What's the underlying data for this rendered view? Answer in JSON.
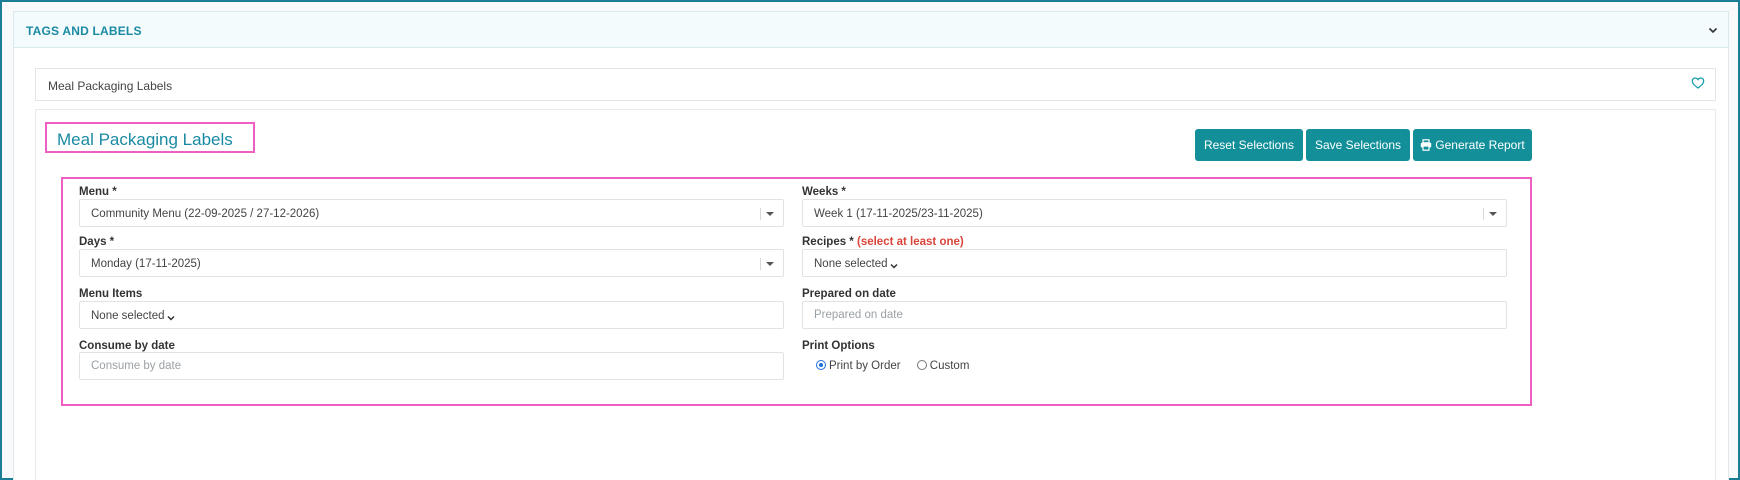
{
  "accordion": {
    "title": "TAGS AND LABELS"
  },
  "breadcrumb": {
    "label": "Meal Packaging Labels"
  },
  "page": {
    "title": "Meal Packaging Labels"
  },
  "toolbar": {
    "reset_label": "Reset Selections",
    "save_label": "Save Selections",
    "report_label": "Generate Report"
  },
  "form": {
    "menu": {
      "label": "Menu *",
      "value": "Community Menu (22-09-2025 / 27-12-2026)"
    },
    "weeks": {
      "label": "Weeks *",
      "value": "Week 1 (17-11-2025/23-11-2025)"
    },
    "days": {
      "label": "Days *",
      "value": "Monday (17-11-2025)"
    },
    "recipes": {
      "label": "Recipes *",
      "note": "(select at least one)",
      "value": "None selected"
    },
    "menu_items": {
      "label": "Menu Items",
      "value": "None selected"
    },
    "prepared_on": {
      "label": "Prepared on date",
      "placeholder": "Prepared on date"
    },
    "consume_by": {
      "label": "Consume by date",
      "placeholder": "Consume by date"
    },
    "print_options": {
      "label": "Print Options",
      "options": [
        "Print by Order",
        "Custom"
      ],
      "selected": "Print by Order"
    }
  },
  "colors": {
    "accent": "#128f99",
    "title": "#1a8aa3",
    "highlight_border": "#ee5fc1",
    "required_note": "#d9453a"
  },
  "icons": [
    "chevron-down-icon",
    "heart-icon",
    "printer-icon",
    "caret-down-icon"
  ]
}
